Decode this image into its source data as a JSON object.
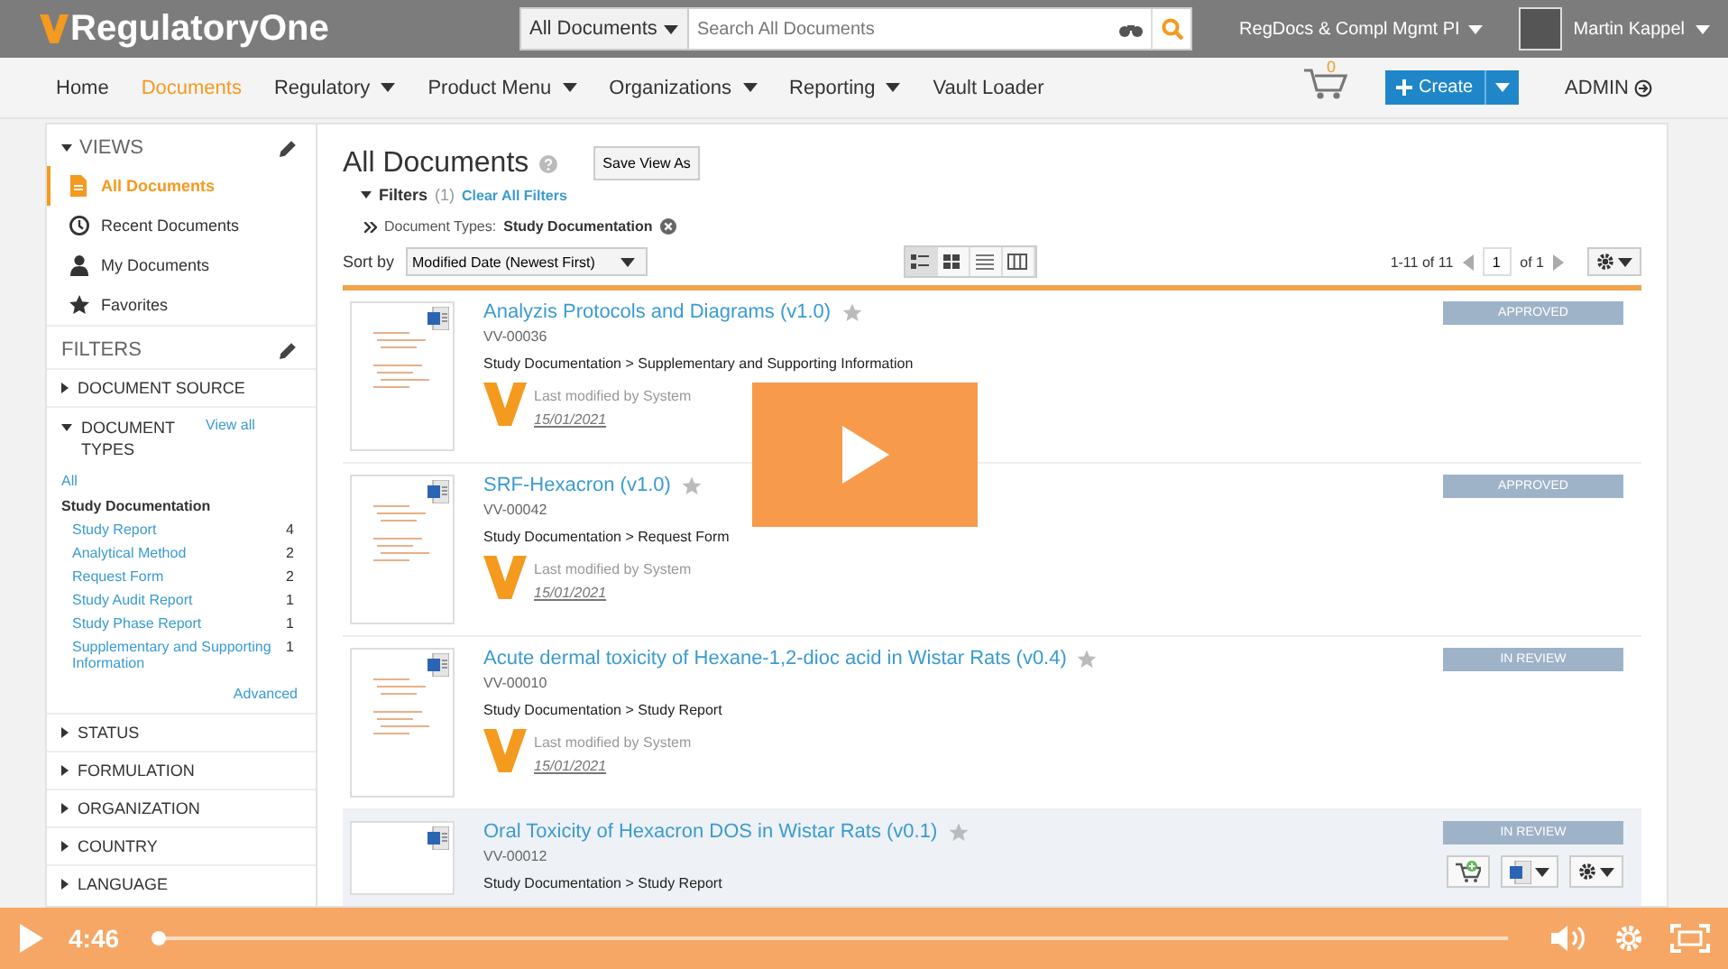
{
  "header": {
    "logo": "RegulatoryOne",
    "search_scope": "All Documents",
    "search": {
      "placeholder": "Search All Documents"
    },
    "vault": "RegDocs & Compl Mgmt PI",
    "user": "Martin Kappel"
  },
  "nav": {
    "items": [
      {
        "label": "Home",
        "selected": false,
        "dropdown": false
      },
      {
        "label": "Documents",
        "selected": true,
        "dropdown": false
      },
      {
        "label": "Regulatory",
        "selected": false,
        "dropdown": true
      },
      {
        "label": "Product Menu",
        "selected": false,
        "dropdown": true
      },
      {
        "label": "Organizations",
        "selected": false,
        "dropdown": true
      },
      {
        "label": "Reporting",
        "selected": false,
        "dropdown": true
      },
      {
        "label": "Vault Loader",
        "selected": false,
        "dropdown": false
      }
    ],
    "cart_count": "0",
    "create": "Create",
    "admin": "ADMIN"
  },
  "sidebar": {
    "views_title": "VIEWS",
    "views": [
      {
        "label": "All Documents",
        "selected": true,
        "kind": "document"
      },
      {
        "label": "Recent Documents",
        "selected": false,
        "kind": "clock"
      },
      {
        "label": "My Documents",
        "selected": false,
        "kind": "person"
      },
      {
        "label": "Favorites",
        "selected": false,
        "kind": "star"
      }
    ],
    "filters_title": "FILTERS",
    "filters": [
      {
        "label": "DOCUMENT SOURCE",
        "expanded": false
      },
      {
        "label": "DOCUMENT TYPES",
        "expanded": true,
        "view_all": "View all",
        "all": "All",
        "group": "Study Documentation",
        "options": [
          {
            "label": "Study Report",
            "count": "4"
          },
          {
            "label": "Analytical Method",
            "count": "2"
          },
          {
            "label": "Request Form",
            "count": "2"
          },
          {
            "label": "Study Audit Report",
            "count": "1"
          },
          {
            "label": "Study Phase Report",
            "count": "1"
          },
          {
            "label": "Supplementary and Supporting Information",
            "count": "1"
          }
        ],
        "advanced": "Advanced"
      },
      {
        "label": "STATUS",
        "expanded": false
      },
      {
        "label": "FORMULATION",
        "expanded": false
      },
      {
        "label": "ORGANIZATION",
        "expanded": false
      },
      {
        "label": "COUNTRY",
        "expanded": false
      },
      {
        "label": "LANGUAGE",
        "expanded": false
      }
    ]
  },
  "main": {
    "title": "All Documents",
    "save_view": "Save View As",
    "filters_label": "Filters",
    "filters_count": "(1)",
    "clear_filters": "Clear All Filters",
    "filter_name": "Document Types:",
    "filter_value": "Study Documentation",
    "sort_label": "Sort by",
    "sort_value": "Modified Date (Newest First)",
    "view_modes": [
      {
        "kind": "detail",
        "selected": true
      },
      {
        "kind": "grid",
        "selected": false
      },
      {
        "kind": "list",
        "selected": false
      },
      {
        "kind": "columns",
        "selected": false
      }
    ],
    "range": "1-11 of 11",
    "page": "1",
    "page_total": "of 1",
    "documents": [
      {
        "title": "Analyzis Protocols and Diagrams (v1.0)",
        "number": "VV-00036",
        "path": "Study Documentation > Supplementary and Supporting Information",
        "modified": "Last modified by System",
        "date": "15/01/2021",
        "status": "APPROVED",
        "hovered": false
      },
      {
        "title": "SRF-Hexacron (v1.0)",
        "number": "VV-00042",
        "path": "Study Documentation > Request Form",
        "modified": "Last modified by System",
        "date": "15/01/2021",
        "status": "APPROVED",
        "hovered": false
      },
      {
        "title": "Acute dermal toxicity of Hexane-1,2-dioc acid in Wistar Rats (v0.4)",
        "number": "VV-00010",
        "path": "Study Documentation > Study Report",
        "modified": "Last modified by System",
        "date": "15/01/2021",
        "status": "IN REVIEW",
        "hovered": false
      },
      {
        "title": "Oral Toxicity of Hexacron DOS in Wistar Rats (v0.1)",
        "number": "VV-00012",
        "path": "Study Documentation > Study Report",
        "status": "IN REVIEW",
        "hovered": true
      }
    ]
  },
  "video": {
    "time": "4:46",
    "level": 0
  }
}
